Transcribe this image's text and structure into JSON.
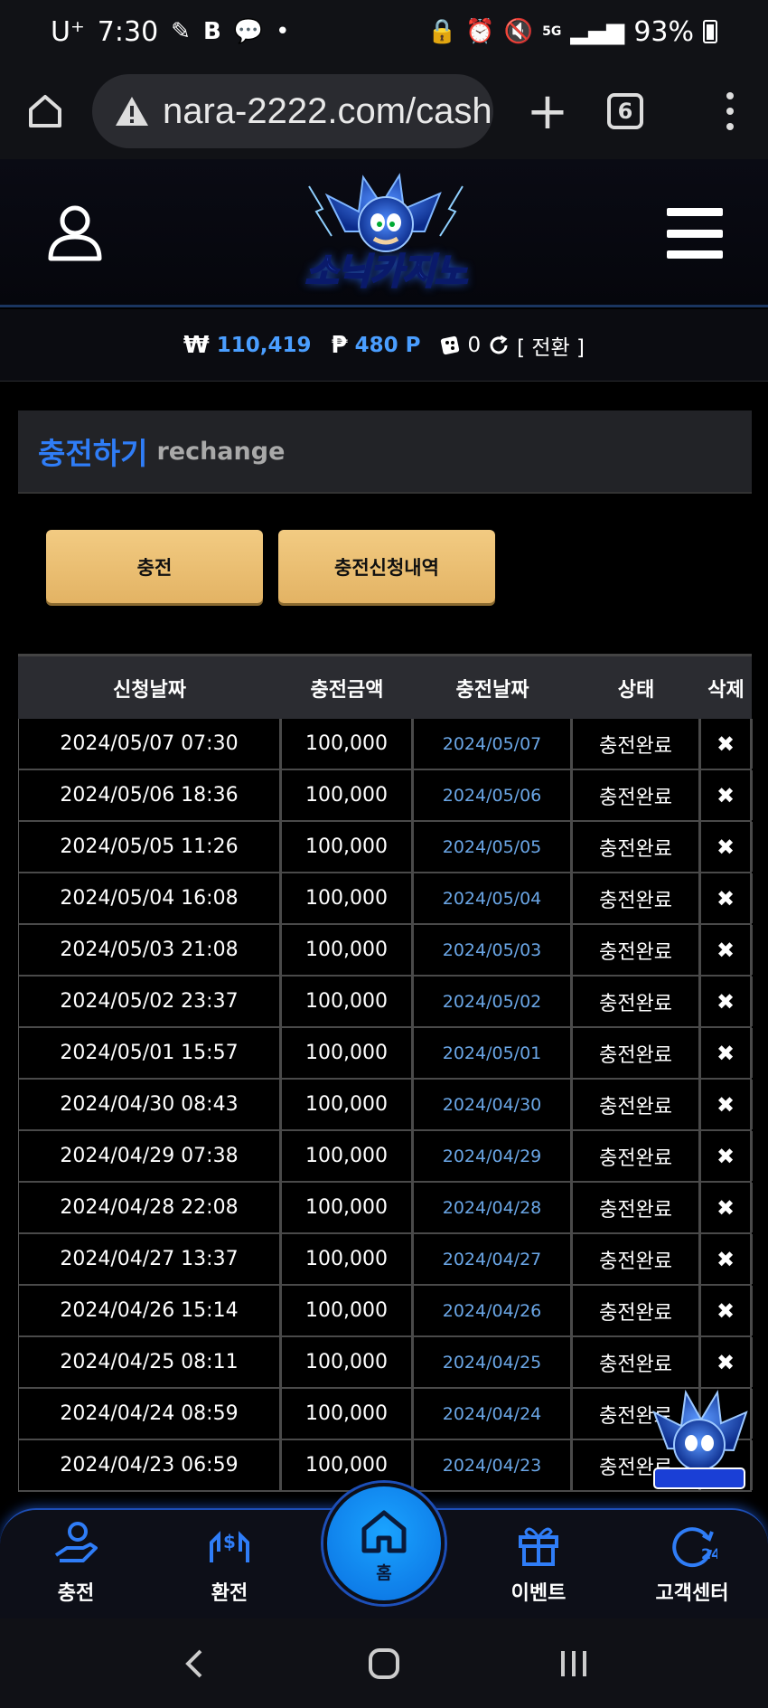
{
  "status": {
    "carrier": "U⁺",
    "time": "7:30",
    "battery": "93%",
    "network": "5G"
  },
  "browser": {
    "url": "nara-2222.com/cash",
    "tab_count": "6"
  },
  "site": {
    "logo_text": "소닉카지노"
  },
  "balance": {
    "money_symbol": "₩",
    "money": "110,419",
    "point_symbol": "₱",
    "point": "480 P",
    "chips": "0",
    "switch_label": "[ 전환 ]"
  },
  "section": {
    "title": "충전하기",
    "subtitle": "rechange"
  },
  "actions": {
    "charge": "충전",
    "history": "충전신청내역"
  },
  "table": {
    "headers": [
      "신청날짜",
      "충전금액",
      "충전날짜",
      "상태",
      "삭제"
    ],
    "rows": [
      {
        "requested": "2024/05/07 07:30",
        "amount": "100,000",
        "charged": "2024/05/07",
        "status": "충전완료",
        "delete": "✖"
      },
      {
        "requested": "2024/05/06 18:36",
        "amount": "100,000",
        "charged": "2024/05/06",
        "status": "충전완료",
        "delete": "✖"
      },
      {
        "requested": "2024/05/05 11:26",
        "amount": "100,000",
        "charged": "2024/05/05",
        "status": "충전완료",
        "delete": "✖"
      },
      {
        "requested": "2024/05/04 16:08",
        "amount": "100,000",
        "charged": "2024/05/04",
        "status": "충전완료",
        "delete": "✖"
      },
      {
        "requested": "2024/05/03 21:08",
        "amount": "100,000",
        "charged": "2024/05/03",
        "status": "충전완료",
        "delete": "✖"
      },
      {
        "requested": "2024/05/02 23:37",
        "amount": "100,000",
        "charged": "2024/05/02",
        "status": "충전완료",
        "delete": "✖"
      },
      {
        "requested": "2024/05/01 15:57",
        "amount": "100,000",
        "charged": "2024/05/01",
        "status": "충전완료",
        "delete": "✖"
      },
      {
        "requested": "2024/04/30 08:43",
        "amount": "100,000",
        "charged": "2024/04/30",
        "status": "충전완료",
        "delete": "✖"
      },
      {
        "requested": "2024/04/29 07:38",
        "amount": "100,000",
        "charged": "2024/04/29",
        "status": "충전완료",
        "delete": "✖"
      },
      {
        "requested": "2024/04/28 22:08",
        "amount": "100,000",
        "charged": "2024/04/28",
        "status": "충전완료",
        "delete": "✖"
      },
      {
        "requested": "2024/04/27 13:37",
        "amount": "100,000",
        "charged": "2024/04/27",
        "status": "충전완료",
        "delete": "✖"
      },
      {
        "requested": "2024/04/26 15:14",
        "amount": "100,000",
        "charged": "2024/04/26",
        "status": "충전완료",
        "delete": "✖"
      },
      {
        "requested": "2024/04/25 08:11",
        "amount": "100,000",
        "charged": "2024/04/25",
        "status": "충전완료",
        "delete": "✖"
      },
      {
        "requested": "2024/04/24 08:59",
        "amount": "100,000",
        "charged": "2024/04/24",
        "status": "충전완료",
        "delete": ""
      },
      {
        "requested": "2024/04/23 06:59",
        "amount": "100,000",
        "charged": "2024/04/23",
        "status": "충전완료",
        "delete": ""
      }
    ]
  },
  "bottom_nav": {
    "charge": "충전",
    "exchange": "환전",
    "home": "홈",
    "event": "이벤트",
    "support": "고객센터"
  },
  "colors": {
    "accent_blue": "#2f7df7",
    "button_gold": "#f2cb82",
    "date_blue": "#6aa6e6"
  }
}
